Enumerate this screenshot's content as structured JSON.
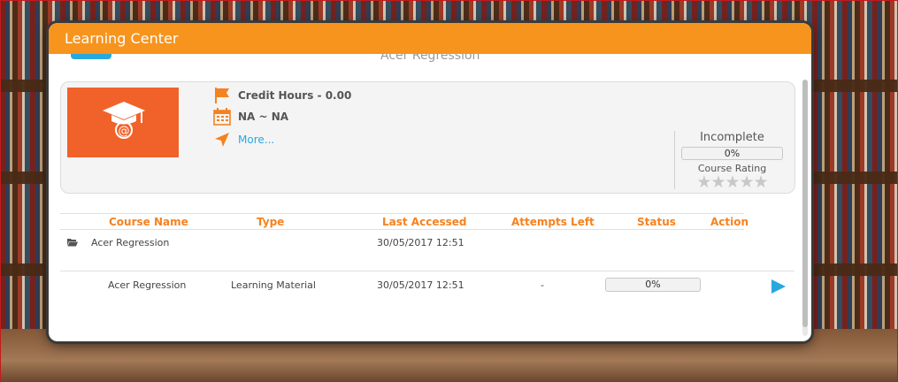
{
  "modal": {
    "title": "Learning Center",
    "subtitle_partial": "Acer Regression"
  },
  "course_card": {
    "credit_hours": "Credit Hours - 0.00",
    "dates": "NA ~ NA",
    "more_link": "More...",
    "status": "Incomplete",
    "progress": "0%",
    "rating_label": "Course Rating",
    "rating_stars": "★★★★★"
  },
  "table": {
    "headers": {
      "course_name": "Course Name",
      "type": "Type",
      "last_accessed": "Last Accessed",
      "attempts_left": "Attempts Left",
      "status": "Status",
      "action": "Action"
    },
    "folder_row": {
      "course_name": "Acer Regression",
      "last_accessed": "30/05/2017 12:51"
    },
    "item_row": {
      "course_name": "Acer Regression",
      "type": "Learning Material",
      "last_accessed": "30/05/2017 12:51",
      "attempts_left": "-",
      "status_progress": "0%"
    }
  },
  "colors": {
    "header_orange": "#f7941d",
    "accent_blue": "#29a8e0",
    "thumb_orange": "#f0622a",
    "table_header_text": "#f58220"
  },
  "icons": [
    "graduation-cap-icon",
    "flag-icon",
    "calendar-icon",
    "navigation-arrow-icon",
    "folder-icon",
    "play-icon"
  ]
}
